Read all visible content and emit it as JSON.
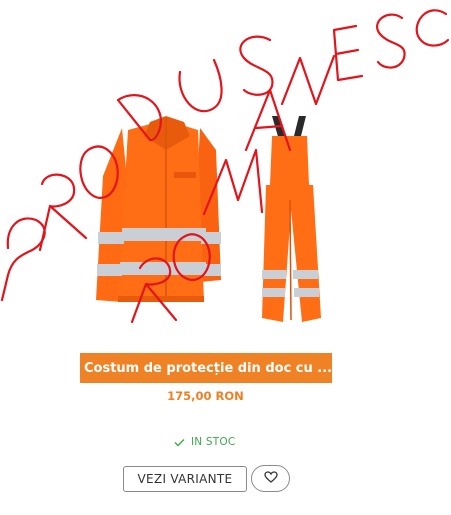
{
  "product": {
    "image_alt": "Costum de protecție din doc cu",
    "title": "Costum de protecție din doc cu ...",
    "price": "175,00 RON",
    "stock_status": "IN STOC",
    "variants_button_label": "VEZI VARIANTE"
  },
  "icons": {
    "stock": "checkmark-icon",
    "wishlist": "heart-icon"
  },
  "colors": {
    "accent": "#f08226",
    "price": "#ef7f22",
    "in_stock": "#3ea94a",
    "garment_orange": "#ff6a13",
    "reflective_stripe": "#c9cfd4",
    "watermark": "#e3141b"
  }
}
